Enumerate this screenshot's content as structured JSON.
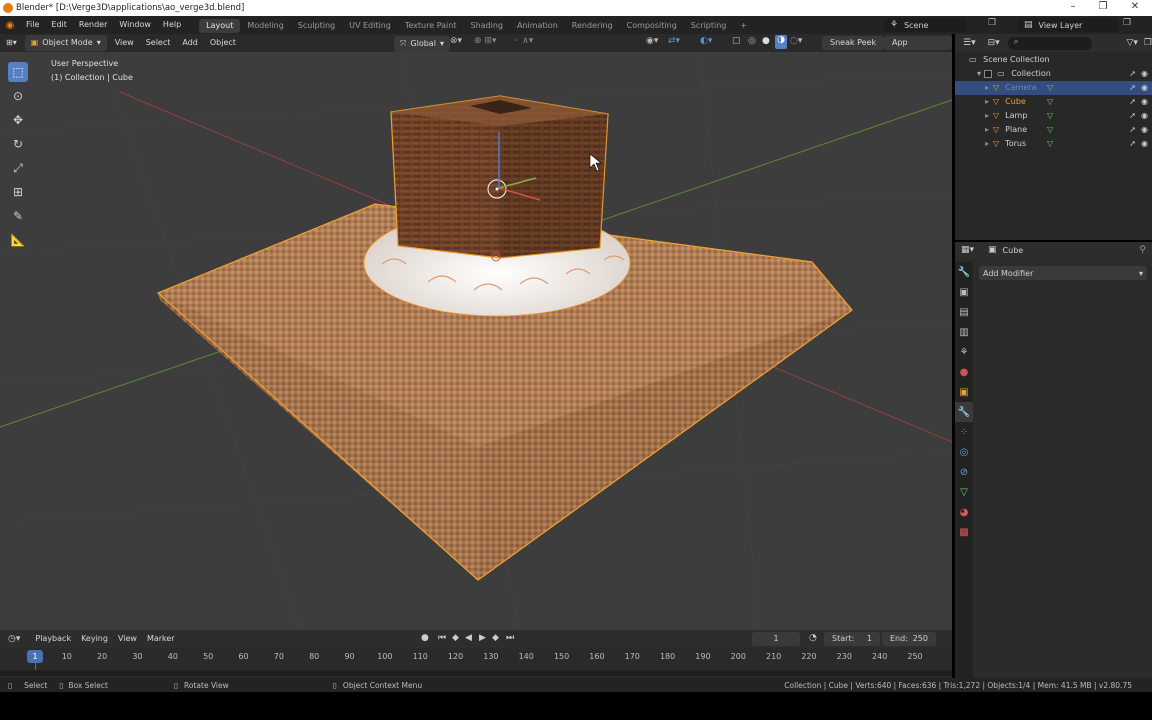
{
  "window": {
    "title": "Blender* [D:\\Verge3D\\applications\\ao_verge3d.blend]",
    "minimize": "–",
    "restore": "❐",
    "close": "✕"
  },
  "menus": [
    "File",
    "Edit",
    "Render",
    "Window",
    "Help"
  ],
  "workspaces": [
    {
      "label": "Layout",
      "active": true
    },
    {
      "label": "Modeling"
    },
    {
      "label": "Sculpting"
    },
    {
      "label": "UV Editing"
    },
    {
      "label": "Texture Paint"
    },
    {
      "label": "Shading"
    },
    {
      "label": "Animation"
    },
    {
      "label": "Rendering"
    },
    {
      "label": "Compositing"
    },
    {
      "label": "Scripting"
    }
  ],
  "add_workspace": "+",
  "scene_name": "Scene",
  "view_layer": "View Layer",
  "viewport_header": {
    "mode": "Object Mode",
    "menus": [
      "View",
      "Select",
      "Add",
      "Object"
    ],
    "orientation": "Global",
    "sneak_peek": "Sneak Peek",
    "app_manager": "App Manager"
  },
  "viewport_overlay": {
    "perspective": "User Perspective",
    "context": "(1) Collection | Cube"
  },
  "outliner": {
    "root": "Scene Collection",
    "collection": "Collection",
    "items": [
      {
        "name": "Camera",
        "selected": true,
        "dim": true
      },
      {
        "name": "Cube",
        "active": true
      },
      {
        "name": "Lamp"
      },
      {
        "name": "Plane"
      },
      {
        "name": "Torus"
      }
    ]
  },
  "properties": {
    "object_name": "Cube",
    "add_modifier": "Add Modifier"
  },
  "timeline": {
    "menus": [
      "Playback",
      "Keying",
      "View",
      "Marker"
    ],
    "current_frame": "1",
    "start_label": "Start:",
    "start": "1",
    "end_label": "End:",
    "end": "250",
    "ticks": [
      "1",
      "10",
      "20",
      "30",
      "40",
      "50",
      "60",
      "70",
      "80",
      "90",
      "100",
      "110",
      "120",
      "130",
      "140",
      "150",
      "160",
      "170",
      "180",
      "190",
      "200",
      "210",
      "220",
      "230",
      "240",
      "250"
    ]
  },
  "statusbar": {
    "select": "Select",
    "box_select": "Box Select",
    "rotate_view": "Rotate View",
    "context_menu": "Object Context Menu",
    "stats": "Collection | Cube | Verts:640 | Faces:636 | Tris:1,272 | Objects:1/4 | Mem: 41.5 MB | v2.80.75"
  },
  "colors": {
    "accent": "#5680c2",
    "selected_row": "#334d80",
    "selection_outline": "#f0a030",
    "viewport_bg": "#3d3d3d"
  }
}
